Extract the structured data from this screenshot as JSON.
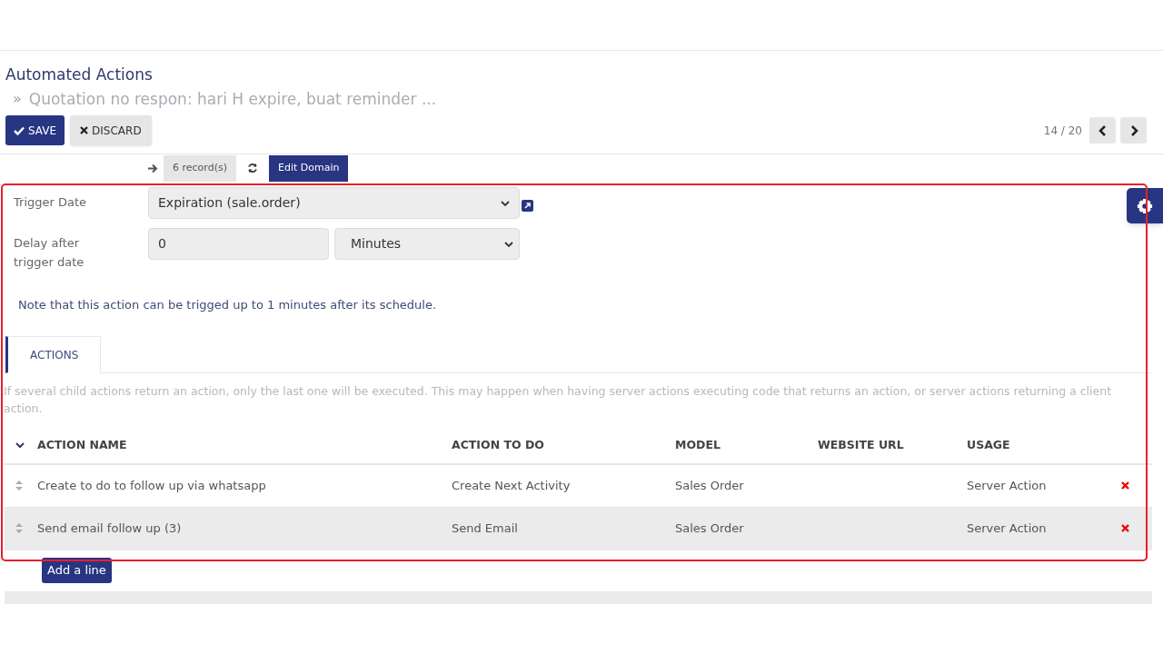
{
  "breadcrumb": {
    "parent": "Automated Actions",
    "separator": "»",
    "current": "Quotation no respon: hari H expire, buat reminder ..."
  },
  "buttons": {
    "save": "SAVE",
    "discard": "DISCARD"
  },
  "pager": {
    "value": "14 / 20"
  },
  "domain": {
    "count": "6 record(s)",
    "edit": "Edit Domain"
  },
  "fields": [
    {
      "label": "Trigger Date",
      "kind": "select-link",
      "value": "Expiration (sale.order)"
    },
    {
      "label": "Delay after trigger date",
      "kind": "number-unit",
      "value": "0",
      "unit": "Minutes"
    }
  ],
  "note": "Note that this action can be trigged up to 1 minutes after its schedule.",
  "tabs": [
    {
      "label": "ACTIONS",
      "selected": true
    }
  ],
  "help": "If several child actions return an action, only the last one will be executed. This may happen when having server actions executing code that returns an action, or server actions returning a client action.",
  "table": {
    "columns": [
      "ACTION NAME",
      "ACTION TO DO",
      "MODEL",
      "WEBSITE URL",
      "USAGE"
    ],
    "rows": [
      {
        "cells": [
          "Create to do to follow up via whatsapp",
          "Create Next Activity",
          "Sales Order",
          "",
          "Server Action"
        ],
        "selected": false
      },
      {
        "cells": [
          "Send email follow up (3)",
          "Send Email",
          "Sales Order",
          "",
          "Server Action"
        ],
        "selected": true
      }
    ],
    "add": "Add a line"
  }
}
